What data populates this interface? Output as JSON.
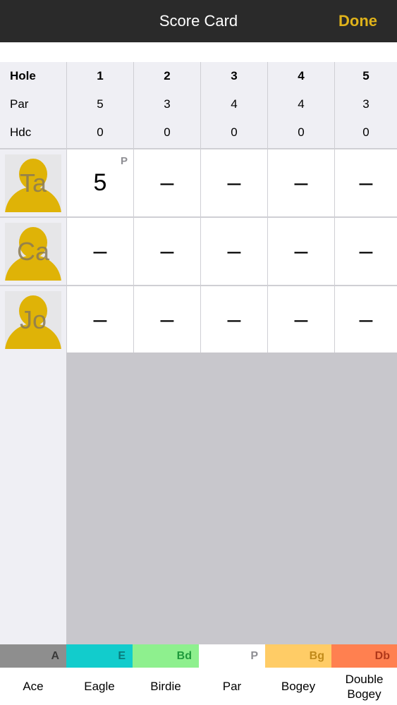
{
  "nav": {
    "title": "Score Card",
    "done_label": "Done"
  },
  "header": {
    "row_labels": [
      "Hole",
      "Par",
      "Hdc"
    ],
    "holes": [
      {
        "hole": "1",
        "par": "5",
        "hdc": "0"
      },
      {
        "hole": "2",
        "par": "3",
        "hdc": "0"
      },
      {
        "hole": "3",
        "par": "4",
        "hdc": "0"
      },
      {
        "hole": "4",
        "par": "4",
        "hdc": "0"
      },
      {
        "hole": "5",
        "par": "3",
        "hdc": "0"
      }
    ]
  },
  "players": [
    {
      "initials": "Ta",
      "scores": [
        {
          "value": "5",
          "badge": "P"
        },
        {
          "value": "–",
          "badge": ""
        },
        {
          "value": "–",
          "badge": ""
        },
        {
          "value": "–",
          "badge": ""
        },
        {
          "value": "–",
          "badge": ""
        }
      ]
    },
    {
      "initials": "Ca",
      "scores": [
        {
          "value": "–",
          "badge": ""
        },
        {
          "value": "–",
          "badge": ""
        },
        {
          "value": "–",
          "badge": ""
        },
        {
          "value": "–",
          "badge": ""
        },
        {
          "value": "–",
          "badge": ""
        }
      ]
    },
    {
      "initials": "Jo",
      "scores": [
        {
          "value": "–",
          "badge": ""
        },
        {
          "value": "–",
          "badge": ""
        },
        {
          "value": "–",
          "badge": ""
        },
        {
          "value": "–",
          "badge": ""
        },
        {
          "value": "–",
          "badge": ""
        }
      ]
    }
  ],
  "legend": [
    {
      "code": "A",
      "label": "Ace",
      "color": "#8e8e8e",
      "code_color": "#3a3a3a"
    },
    {
      "code": "E",
      "label": "Eagle",
      "color": "#12cccc",
      "code_color": "#0a7a7a"
    },
    {
      "code": "Bd",
      "label": "Birdie",
      "color": "#8ef08e",
      "code_color": "#1f9a3c"
    },
    {
      "code": "P",
      "label": "Par",
      "color": "#ffffff",
      "code_color": "#8e8e93"
    },
    {
      "code": "Bg",
      "label": "Bogey",
      "color": "#ffcc66",
      "code_color": "#c08a1a"
    },
    {
      "code": "Db",
      "label": "Double Bogey",
      "color": "#ff8050",
      "code_color": "#b0381a"
    }
  ],
  "colors": {
    "accent": "#e0b31a",
    "navbar": "#2a2a2a",
    "avatar": "#dfb307"
  }
}
